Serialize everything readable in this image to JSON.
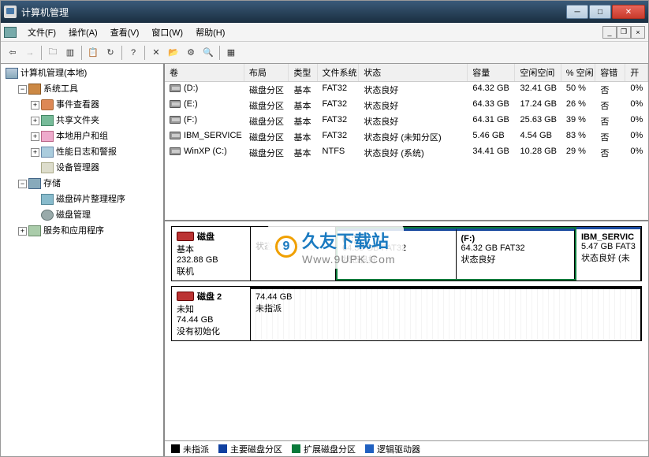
{
  "titlebar": {
    "title": "计算机管理"
  },
  "menu": {
    "file": "文件(F)",
    "action": "操作(A)",
    "view": "查看(V)",
    "window": "窗口(W)",
    "help": "帮助(H)"
  },
  "tree": {
    "root": "计算机管理(本地)",
    "system_tools": "系统工具",
    "event_viewer": "事件查看器",
    "shared_folders": "共享文件夹",
    "local_users": "本地用户和组",
    "perf_logs": "性能日志和警报",
    "device_mgr": "设备管理器",
    "storage": "存储",
    "defrag": "磁盘碎片整理程序",
    "disk_mgmt": "磁盘管理",
    "services": "服务和应用程序"
  },
  "columns": {
    "volume": "卷",
    "layout": "布局",
    "type": "类型",
    "fs": "文件系统",
    "status": "状态",
    "capacity": "容量",
    "free": "空闲空间",
    "pct": "% 空闲",
    "fault": "容错",
    "overhead": "开"
  },
  "volumes": [
    {
      "name": "(D:)",
      "layout": "磁盘分区",
      "type": "基本",
      "fs": "FAT32",
      "status": "状态良好",
      "cap": "64.32 GB",
      "free": "32.41 GB",
      "pct": "50 %",
      "fault": "否",
      "oh": "0%"
    },
    {
      "name": "(E:)",
      "layout": "磁盘分区",
      "type": "基本",
      "fs": "FAT32",
      "status": "状态良好",
      "cap": "64.33 GB",
      "free": "17.24 GB",
      "pct": "26 %",
      "fault": "否",
      "oh": "0%"
    },
    {
      "name": "(F:)",
      "layout": "磁盘分区",
      "type": "基本",
      "fs": "FAT32",
      "status": "状态良好",
      "cap": "64.31 GB",
      "free": "25.63 GB",
      "pct": "39 %",
      "fault": "否",
      "oh": "0%"
    },
    {
      "name": "IBM_SERVICE",
      "layout": "磁盘分区",
      "type": "基本",
      "fs": "FAT32",
      "status": "状态良好 (未知分区)",
      "cap": "5.46 GB",
      "free": "4.54 GB",
      "pct": "83 %",
      "fault": "否",
      "oh": "0%"
    },
    {
      "name": "WinXP (C:)",
      "layout": "磁盘分区",
      "type": "基本",
      "fs": "NTFS",
      "status": "状态良好 (系统)",
      "cap": "34.41 GB",
      "free": "10.28 GB",
      "pct": "29 %",
      "fault": "否",
      "oh": "0%"
    }
  ],
  "disks": [
    {
      "name": "磁盘",
      "type": "基本",
      "size": "232.88 GB",
      "state": "联机",
      "parts": [
        {
          "name": "",
          "info": "状态良好 (系统)",
          "cls": "hidden-sys"
        },
        {
          "name": "(E:)",
          "info": "64.35 GB FAT32",
          "status": "状态良好"
        },
        {
          "name": "(F:)",
          "info": "64.32 GB FAT32",
          "status": "状态良好"
        },
        {
          "name": "IBM_SERVIC",
          "info": "5.47 GB FAT3",
          "status": "状态良好 (未"
        }
      ]
    },
    {
      "name": "磁盘 2",
      "type": "未知",
      "size": "74.44 GB",
      "state": "没有初始化",
      "parts": [
        {
          "name": "",
          "info": "74.44 GB",
          "status": "未指派"
        }
      ]
    }
  ],
  "legend": {
    "unalloc": "未指派",
    "primary": "主要磁盘分区",
    "extended": "扩展磁盘分区",
    "logical": "逻辑驱动器"
  },
  "watermark": {
    "logo": "9",
    "main": "久友下载站",
    "sub": "Www.9UPK.Com"
  }
}
